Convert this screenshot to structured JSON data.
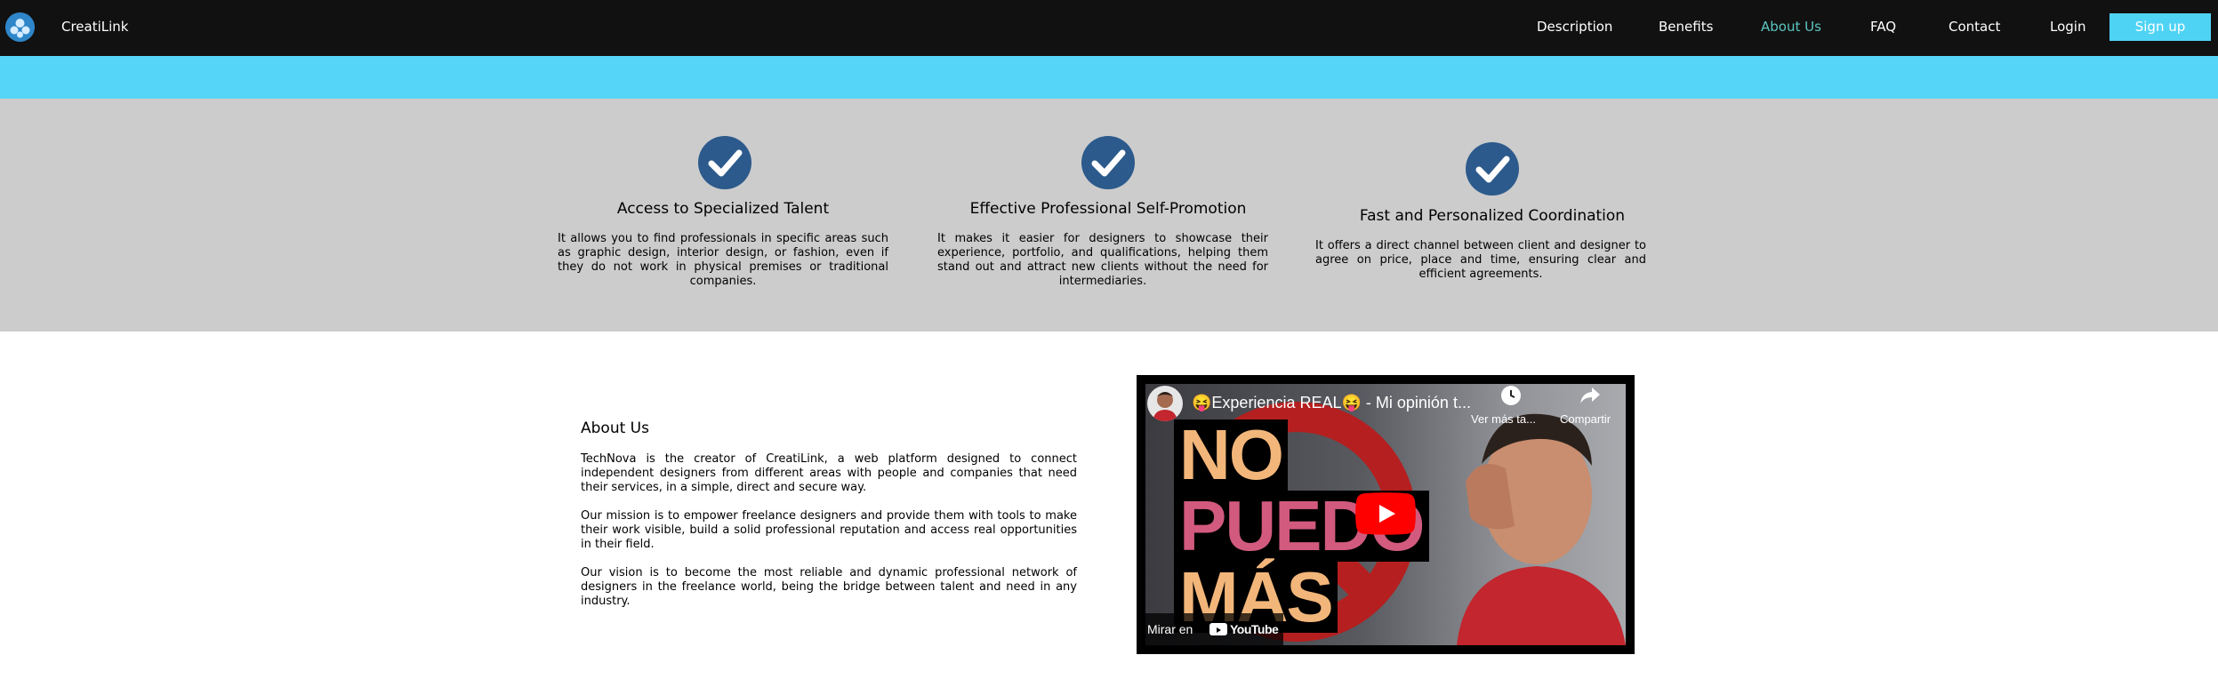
{
  "nav": {
    "brand": "CreatiLink",
    "links": [
      "Description",
      "Benefits",
      "About Us",
      "FAQ",
      "Contact",
      "Login"
    ],
    "active": "About Us",
    "signup": "Sign up"
  },
  "colors": {
    "navbar": "#111111",
    "accent_cyan": "#55d6f8",
    "active_link": "#5cc5c1",
    "check_icon": "#2c5a8c",
    "benefits_bg": "#cccccc"
  },
  "benefits": [
    {
      "icon": "check-circle-icon",
      "title": "Access to Specialized Talent",
      "text": "It allows you to find professionals in specific areas such as graphic design, interior design, or fashion, even if they do not work in physical premises or traditional companies."
    },
    {
      "icon": "check-circle-icon",
      "title": "Effective Professional Self-Promotion",
      "text": "It makes it easier for designers to showcase their experience, portfolio, and qualifications, helping them stand out and attract new clients without the need for intermediaries."
    },
    {
      "icon": "check-circle-icon",
      "title": "Fast and Personalized Coordination",
      "text": "It offers a direct channel between client and designer to agree on price, place and time, ensuring clear and efficient agreements."
    }
  ],
  "about": {
    "title": "About Us",
    "paragraphs": [
      "TechNova is the creator of CreatiLink, a web platform designed to connect independent designers from different areas with people and companies that need their services, in a simple, direct and secure way.",
      "Our mission is to empower freelance designers and provide them with tools to make their work visible, build a solid professional reputation and access real opportunities in their field.",
      "Our vision is to become the most reliable and dynamic professional network of designers in the freelance world, being the bridge between talent and need in any industry."
    ]
  },
  "video": {
    "title": "😝Experiencia REAL😝 - Mi opinión t...",
    "watch_later": "Ver más ta...",
    "share": "Compartir",
    "watch_on": "Mirar en",
    "youtube": "YouTube",
    "thumb_lines": [
      "NO",
      "PUEDO",
      "MÁS"
    ]
  }
}
